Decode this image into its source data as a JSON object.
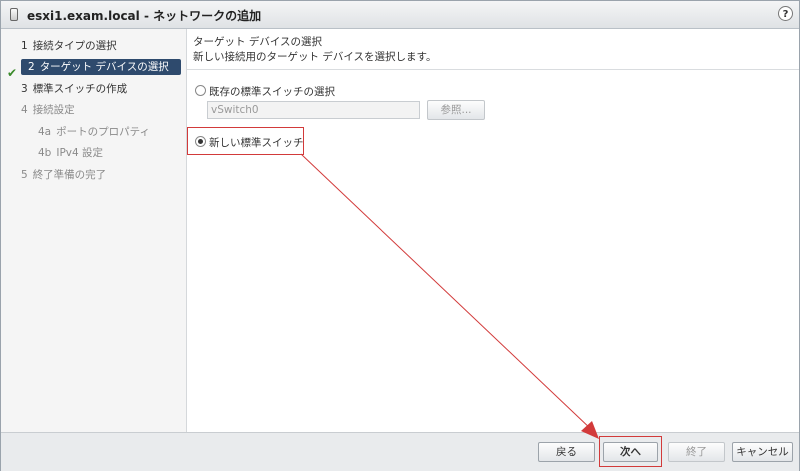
{
  "window": {
    "title": "esxi1.exam.local - ネットワークの追加",
    "help": "?"
  },
  "steps": [
    {
      "num": "1",
      "label": "接続タイプの選択",
      "state": "done"
    },
    {
      "num": "2",
      "label": "ターゲット デバイスの選択",
      "state": "active"
    },
    {
      "num": "3",
      "label": "標準スイッチの作成",
      "state": "normal"
    },
    {
      "num": "4",
      "label": "接続設定",
      "state": "disabled"
    },
    {
      "num": "4a",
      "label": "ポートのプロパティ",
      "state": "disabled"
    },
    {
      "num": "4b",
      "label": "IPv4 設定",
      "state": "disabled"
    },
    {
      "num": "5",
      "label": "終了準備の完了",
      "state": "disabled"
    }
  ],
  "page": {
    "title": "ターゲット デバイスの選択",
    "description": "新しい接続用のターゲット デバイスを選択します。"
  },
  "options": {
    "existing_switch": {
      "label": "既存の標準スイッチの選択",
      "checked": false
    },
    "switch_field": {
      "value": "vSwitch0"
    },
    "browse_button": "参照...",
    "new_switch": {
      "label": "新しい標準スイッチ",
      "checked": true
    }
  },
  "footer": {
    "back": "戻る",
    "next": "次へ",
    "finish": "終了",
    "cancel": "キャンセル"
  },
  "colors": {
    "accent": "#2e4a6d",
    "highlight": "#d23a3a",
    "check": "#3a8a2a"
  },
  "icons": [
    "window-icon",
    "help-icon",
    "check-icon",
    "radio-icon"
  ]
}
